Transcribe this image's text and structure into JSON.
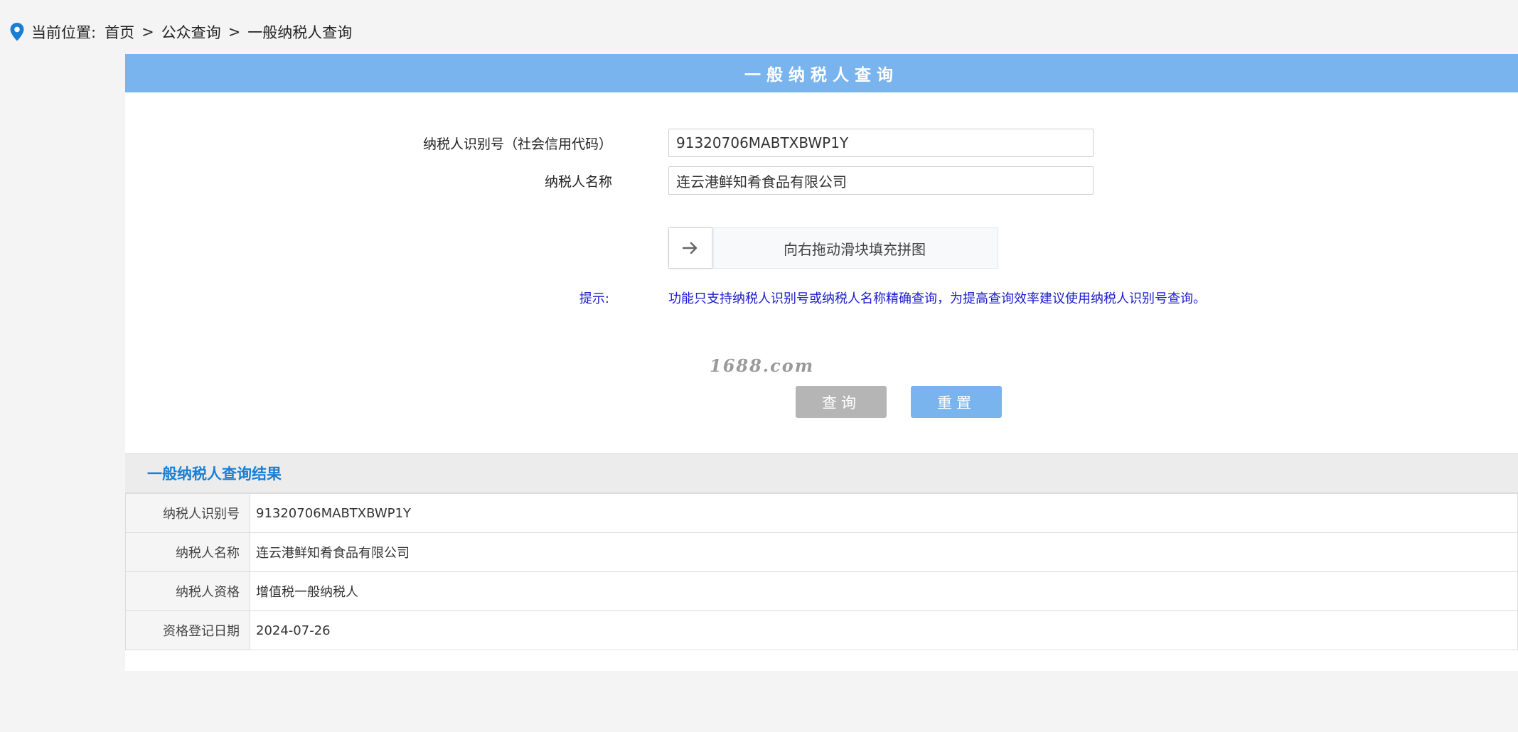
{
  "breadcrumb": {
    "prefix": "当前位置:",
    "items": [
      "首页",
      "公众查询",
      "一般纳税人查询"
    ],
    "separator": ">"
  },
  "title": "一般纳税人查询",
  "form": {
    "taxpayer_id_label": "纳税人识别号（社会信用代码）",
    "taxpayer_id_value": "91320706MABTXBWP1Y",
    "taxpayer_name_label": "纳税人名称",
    "taxpayer_name_value": "连云港鲜知肴食品有限公司",
    "slider_text": "向右拖动滑块填充拼图",
    "hint_label": "提示:",
    "hint_text": "功能只支持纳税人识别号或纳税人名称精确查询，为提高查询效率建议使用纳税人识别号查询。",
    "query_button": "查询",
    "reset_button": "重置"
  },
  "watermark": "1688.com",
  "results": {
    "title": "一般纳税人查询结果",
    "rows": [
      {
        "key": "纳税人识别号",
        "value": "91320706MABTXBWP1Y"
      },
      {
        "key": "纳税人名称",
        "value": "连云港鲜知肴食品有限公司"
      },
      {
        "key": "纳税人资格",
        "value": "增值税一般纳税人"
      },
      {
        "key": "资格登记日期",
        "value": "2024-07-26"
      }
    ]
  },
  "icons": {
    "location": "location-pin-icon",
    "slider_handle": "arrow-right-icon"
  },
  "colors": {
    "title_bar": "#7ab4ee",
    "reset_button": "#7ab4ee",
    "query_button": "#b5b5b5",
    "results_title": "#1a7fd4",
    "hint": "#1a1acc",
    "pin": "#1a7fd4"
  }
}
